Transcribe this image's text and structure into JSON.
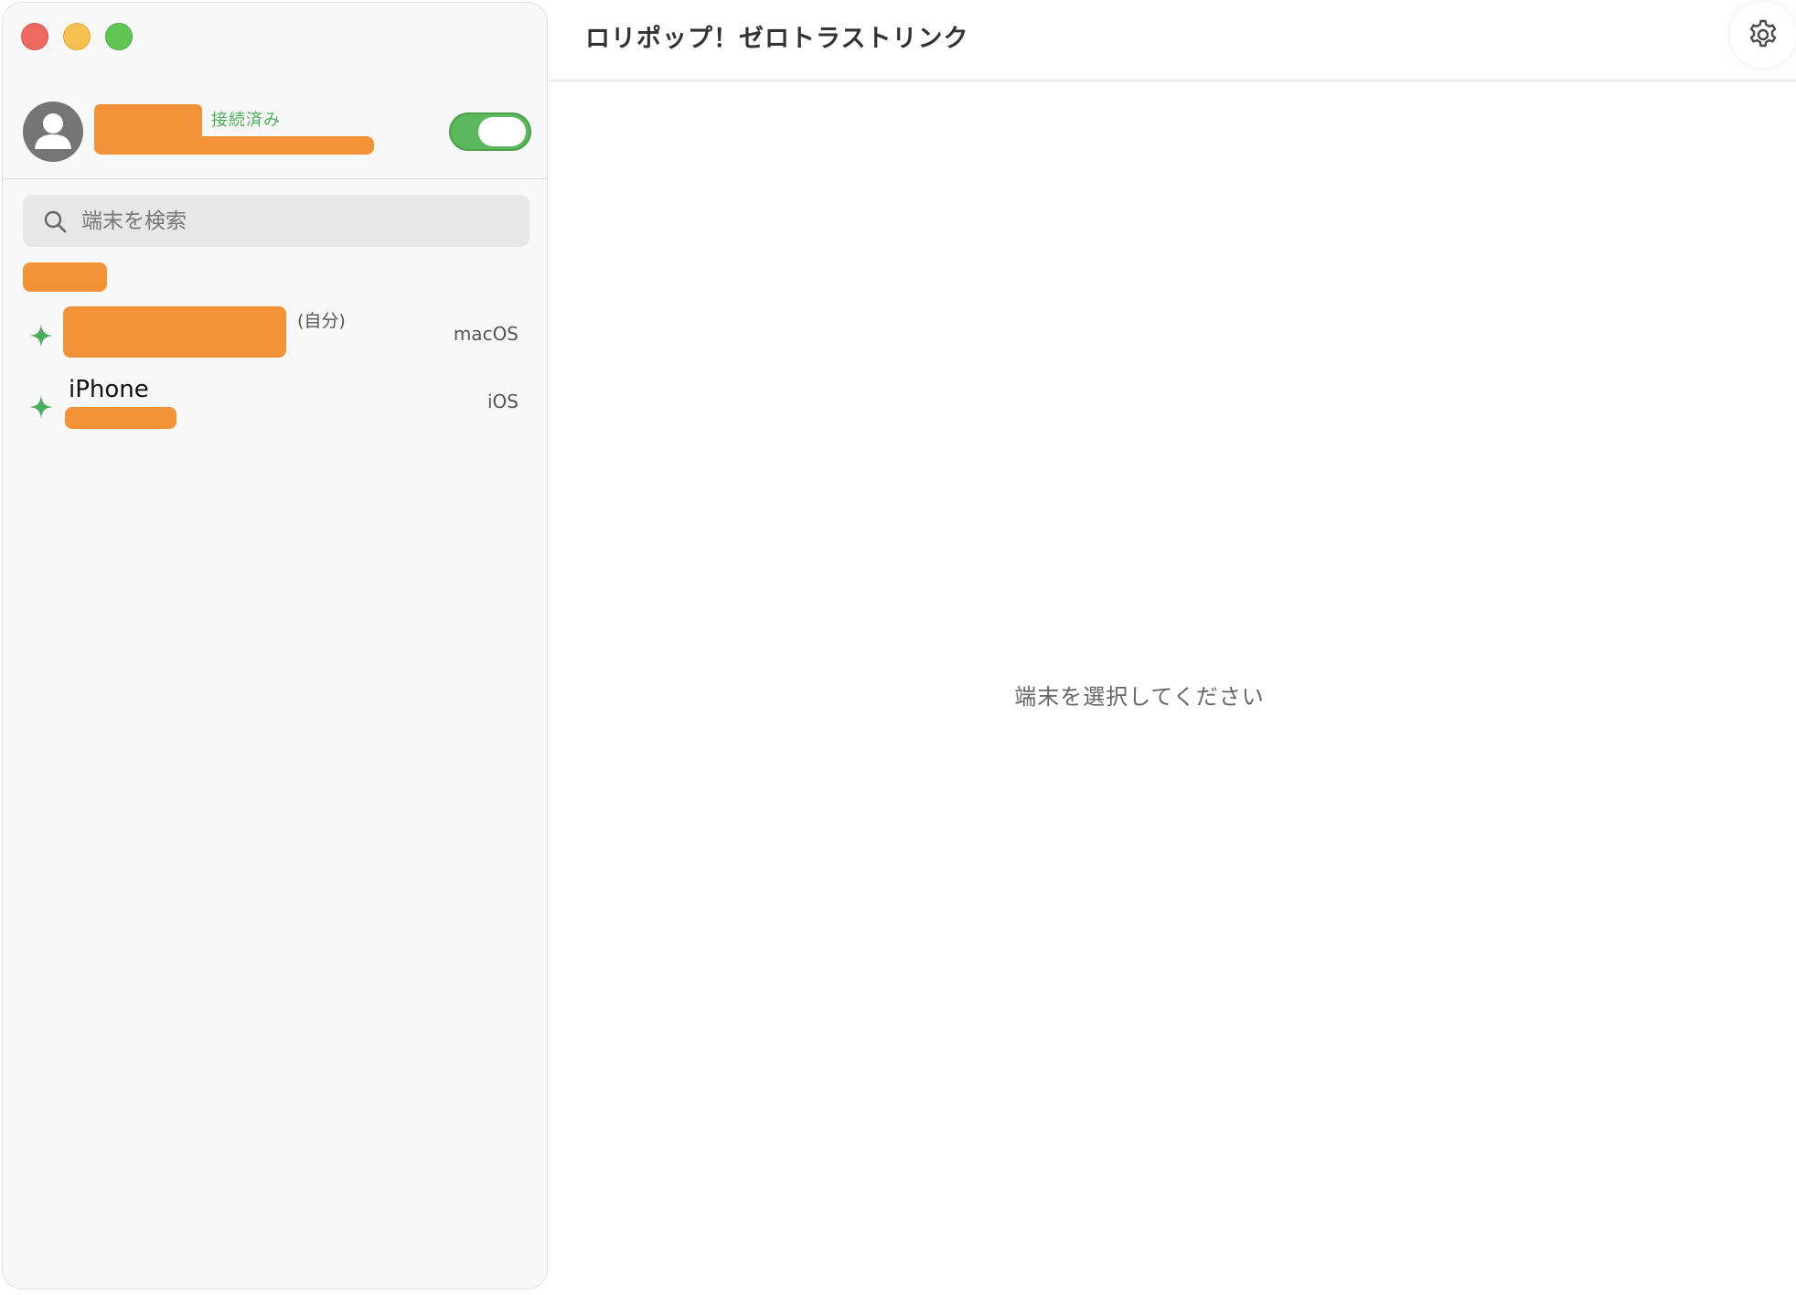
{
  "window": {
    "title": "ロリポップ！ゼロトラストリンク"
  },
  "account": {
    "status": "接続済み",
    "vpn_enabled": true
  },
  "search": {
    "placeholder": "端末を検索",
    "value": ""
  },
  "devices": [
    {
      "self_label": "(自分)",
      "os": "macOS",
      "online": true
    },
    {
      "name": "iPhone",
      "os": "iOS",
      "online": true
    }
  ],
  "main": {
    "empty_message": "端末を選択してください"
  },
  "colors": {
    "online": "#4cae5a",
    "toggle_on": "#5cb85c",
    "redaction": "#f29339"
  },
  "icons": {
    "avatar": "person-avatar-icon",
    "search": "magnifier-icon",
    "device_status": "sparkle-icon",
    "settings": "gear-icon"
  }
}
